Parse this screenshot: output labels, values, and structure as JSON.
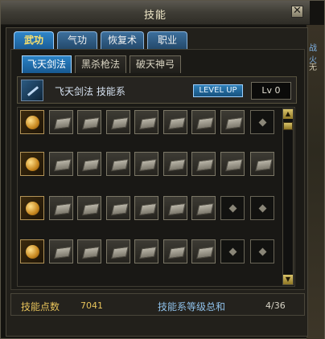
{
  "window": {
    "title": "技能",
    "close_glyph": "✕"
  },
  "main_tabs": [
    {
      "label": "武功",
      "active": true
    },
    {
      "label": "气功",
      "active": false
    },
    {
      "label": "恢复术",
      "active": false
    },
    {
      "label": "职业",
      "active": false
    }
  ],
  "sub_tabs": [
    {
      "label": "飞天剑法",
      "active": true
    },
    {
      "label": "黑杀枪法",
      "active": false
    },
    {
      "label": "破天神弓",
      "active": false
    }
  ],
  "skillbar": {
    "title": "飞天剑法 技能系",
    "levelup_label": "LEVEL UP",
    "level_text": "Lv 0"
  },
  "skill_rows": [
    [
      "skill",
      "book",
      "book",
      "book",
      "book",
      "book",
      "book",
      "book",
      "empty"
    ],
    [
      "skill",
      "book",
      "book",
      "book",
      "book",
      "book",
      "book",
      "book",
      "book"
    ],
    [
      "skill",
      "book",
      "book",
      "book",
      "book",
      "book",
      "book",
      "empty",
      "empty"
    ],
    [
      "skill",
      "book",
      "book",
      "book",
      "book",
      "book",
      "book",
      "empty",
      "empty"
    ]
  ],
  "footer": {
    "points_label": "技能点数",
    "points_value": "7041",
    "total_label": "技能系等级总和",
    "total_value": "4/36"
  },
  "edge": {
    "text1": "战火",
    "text2": "无"
  },
  "colors": {
    "accent_blue": "#2b83c6",
    "gold": "#e6c25a"
  }
}
